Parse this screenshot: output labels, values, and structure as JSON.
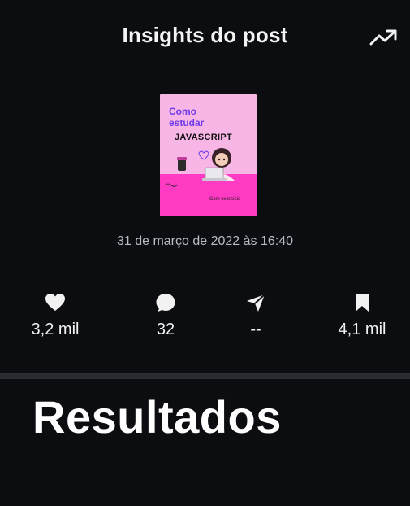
{
  "header": {
    "title": "Insights do post"
  },
  "post": {
    "thumbnail": {
      "line1": "Como",
      "line2": "estudar",
      "line3": "JAVASCRIPT",
      "line4": "Com exercício"
    },
    "date": "31 de março de 2022 às 16:40"
  },
  "stats": [
    {
      "icon": "heart-icon",
      "value": "3,2 mil"
    },
    {
      "icon": "comment-icon",
      "value": "32"
    },
    {
      "icon": "send-icon",
      "value": "--"
    },
    {
      "icon": "bookmark-icon",
      "value": "4,1 mil"
    }
  ],
  "section": {
    "title": "Resultados"
  },
  "colors": {
    "background": "#0c0d11",
    "divider": "#2a2b30",
    "thumb_light_pink": "#f8b6e6",
    "thumb_hot_pink": "#ff3bc4",
    "thumb_purple": "#6d3be8"
  }
}
